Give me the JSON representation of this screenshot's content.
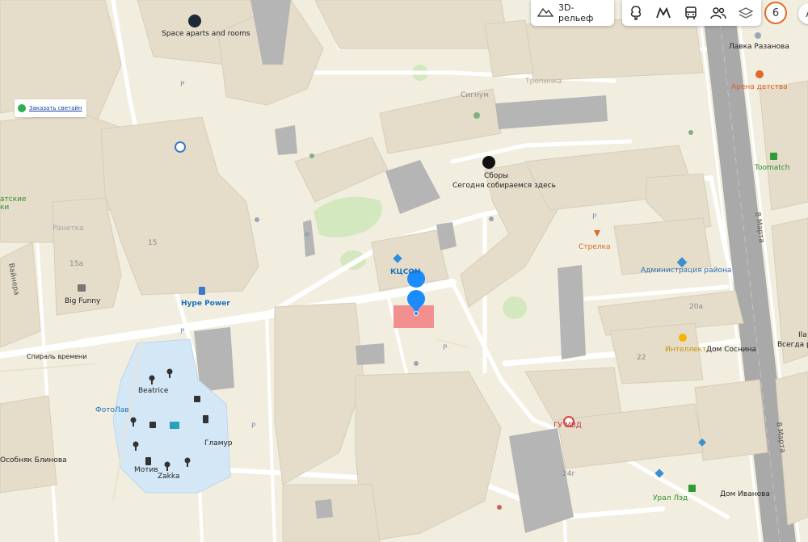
{
  "toolbar": {
    "relief_label": "3D-рельеф",
    "mode_icons": [
      "tree-icon",
      "metro-icon",
      "bus-icon",
      "people-icon",
      "layers-icon"
    ],
    "badge_number": "6",
    "badge_partial": "А"
  },
  "popup": {
    "link_text": "Заказать светайн"
  },
  "pois": {
    "space_aparts": "Space aparts and rooms",
    "sbory": "Сборы",
    "sbory_sub": "Сегодня собираемся здесь",
    "kcson": "КЦСОН",
    "hype_power": "Hype Power",
    "big_funny": "Big Funny",
    "spiral": "Спираль времени",
    "beatrice": "Beatrice",
    "fotolav": "ФотоЛав",
    "glamur": "Гламур",
    "motiv": "Мотив",
    "zakka": "Zakka",
    "osobnyak": "Особняк Блинова",
    "gu_mvd": "ГУ МВД",
    "strelka": "Стрелка",
    "admin": "Администрация района",
    "intellekt": "Интеллект",
    "dom_sosnina": "Дом Соснина",
    "ural_led": "Урал Лэд",
    "dom_ivanova": "Дом Иванова",
    "toomatch": "Toomatch",
    "arena": "Арена детства",
    "lavka": "Лавка Разанова",
    "signum": "Сигнум",
    "tropinka": "Тропинка",
    "partial_left": "атские\nки",
    "partial_right_1": "Вcегда р",
    "partial_right_2": "Ila"
  },
  "streets": {
    "vaynera": "Вайнера",
    "march8_a": "8 Марта",
    "march8_b": "8 Марта"
  },
  "house_numbers": {
    "n15": "15",
    "n15a": "15а",
    "n20a": "20а",
    "n22": "22",
    "n24g": "24г",
    "rnetka": "Ранетка"
  },
  "parking": "P",
  "colors": {
    "background": "#f1eedf",
    "building": "#e4dcc8",
    "building_dark": "#d3cbb7",
    "grey_building": "#b3b3b3",
    "road": "#ffffff",
    "highway": "#a8a8a8",
    "green": "#cfe6b8",
    "mall": "#d3e6f6",
    "selected": "#f28c8c",
    "pin": "#1a8cff",
    "accent": "#e06a2b"
  },
  "icons": {
    "pin": "location-pin-icon",
    "parking": "parking-icon",
    "shop": "shop-icon",
    "cafe": "cafe-icon",
    "government": "government-icon",
    "police": "police-icon"
  }
}
